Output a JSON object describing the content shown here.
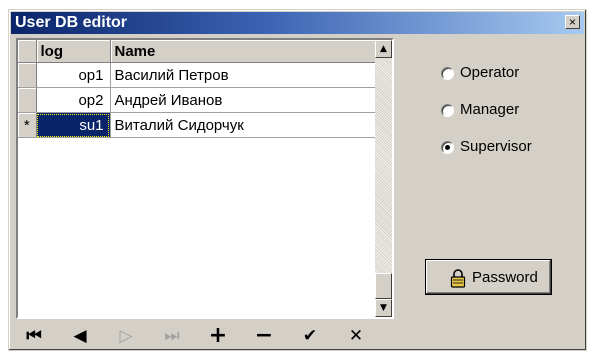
{
  "window": {
    "title": "User DB editor",
    "close_glyph": "×"
  },
  "grid": {
    "columns": [
      "log",
      "Name"
    ],
    "rows": [
      {
        "indicator": "",
        "log": "op1",
        "name": "Василий Петров"
      },
      {
        "indicator": "",
        "log": "op2",
        "name": "Андрей Иванов"
      },
      {
        "indicator": "*",
        "log": "su1",
        "name": "Виталий Сидорчук"
      }
    ]
  },
  "scrollbar": {
    "up_icon": "▲",
    "down_icon": "▼"
  },
  "navigator": [
    {
      "name": "first-record-button",
      "glyph": "⏮",
      "enabled": true
    },
    {
      "name": "prior-record-button",
      "glyph": "◀",
      "enabled": true
    },
    {
      "name": "next-record-button",
      "glyph": "▷",
      "enabled": false
    },
    {
      "name": "last-record-button",
      "glyph": "⏭",
      "enabled": false
    },
    {
      "name": "insert-record-button",
      "glyph": "+",
      "enabled": true
    },
    {
      "name": "delete-record-button",
      "glyph": "−",
      "enabled": true
    },
    {
      "name": "post-edit-button",
      "glyph": "✔",
      "enabled": true
    },
    {
      "name": "cancel-edit-button",
      "glyph": "✕",
      "enabled": true
    }
  ],
  "roles": {
    "options": [
      "Operator",
      "Manager",
      "Supervisor"
    ],
    "selected": "Supervisor"
  },
  "password_button": {
    "label": "Password",
    "icon": "lock-icon"
  },
  "colors": {
    "title_start": "#0a246a",
    "title_end": "#a6caf0",
    "face": "#d4d0c8",
    "selection": "#0a246a"
  }
}
